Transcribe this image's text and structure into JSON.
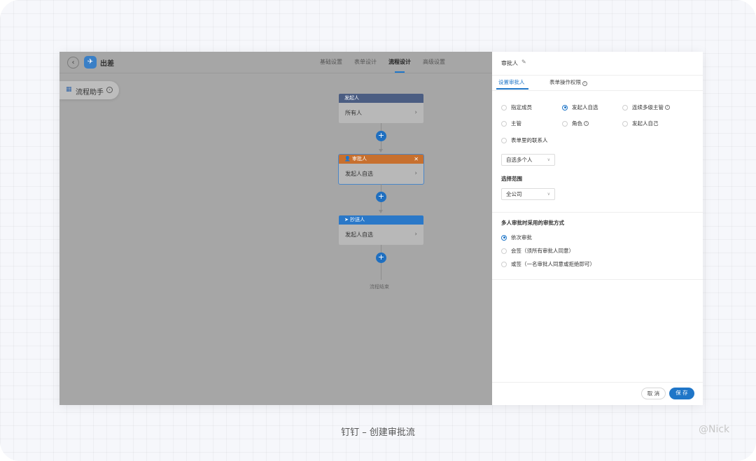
{
  "header": {
    "back_icon": "chevron-left-icon",
    "app_icon": "plane-icon",
    "title": "出差",
    "tabs": [
      {
        "label": "基础设置"
      },
      {
        "label": "表单设计"
      },
      {
        "label": "流程设计",
        "active": true
      },
      {
        "label": "高级设置"
      }
    ]
  },
  "helper": {
    "label": "流程助手",
    "icon": "grid-icon",
    "arrow_icon": "circle-chevron-right-icon"
  },
  "flow": {
    "nodes": [
      {
        "head": "发起人",
        "body": "所有人",
        "head_color": "#4b5d82"
      },
      {
        "head": "审批人",
        "body": "发起人自选",
        "head_color": "#c7702f",
        "selected": true
      },
      {
        "head": "抄送人",
        "body": "发起人自选",
        "head_color": "#2a78c8"
      }
    ],
    "end_label": "流程结束"
  },
  "panel": {
    "title": "审批人",
    "tabs": [
      {
        "label": "设置审批人",
        "active": true
      },
      {
        "label": "表单操作权限"
      }
    ],
    "options": [
      {
        "label": "指定成员",
        "checked": false
      },
      {
        "label": "发起人自选",
        "checked": true
      },
      {
        "label": "连续多级主管",
        "checked": false,
        "info": true
      },
      {
        "label": "主管",
        "checked": false
      },
      {
        "label": "角色",
        "checked": false,
        "info": true
      },
      {
        "label": "发起人自己",
        "checked": false
      },
      {
        "label": "表单里的联系人",
        "checked": false
      }
    ],
    "select_mode": "自选多个人",
    "scope_label": "选择范围",
    "scope_value": "全公司",
    "method_label": "多人审批时采用的审批方式",
    "methods": [
      {
        "label": "依次审批",
        "checked": true
      },
      {
        "label": "会签（须所有审批人同意）",
        "checked": false
      },
      {
        "label": "或签（一名审批人同意或拒绝即可）",
        "checked": false
      }
    ],
    "cancel_label": "取 消",
    "save_label": "保 存"
  },
  "caption": "钉钉 – 创建审批流",
  "watermark": "@Nick",
  "accent_color": "#1f76c8"
}
